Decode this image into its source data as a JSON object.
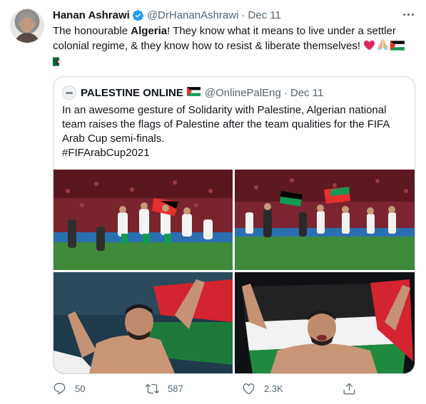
{
  "tweet": {
    "author_name": "Hanan Ashrawi",
    "handle": "@DrHananAshrawi",
    "separator": "·",
    "date": "Dec 11",
    "text_before": "The honourable ",
    "text_bold": "Algeria",
    "text_after": "! They know what it means to live under a settler colonial regime, & they know how to resist & liberate themselves!",
    "emojis": [
      "red-heart",
      "folded-hands",
      "palestine-flag",
      "algeria-flag"
    ]
  },
  "quote": {
    "author_name": "PALESTINE ONLINE",
    "handle": "@OnlinePalEng",
    "separator": "·",
    "date": "Dec 11",
    "text": "In an awesome gesture of Solidarity with Palestine, Algerian national team raises the flags of Palestine after the team qualities for the FIFA Arab Cup semi-finals.",
    "hashtag": "#FIFArabCup2021",
    "images": [
      "team-celebration-photo-1",
      "team-celebration-photo-2",
      "player-with-flag-photo-1",
      "player-with-flag-photo-2"
    ]
  },
  "actions": {
    "replies": "50",
    "retweets": "587",
    "likes": "2.3K"
  },
  "colors": {
    "text": "#0f1419",
    "secondary": "#536471",
    "border": "#cfd9de",
    "verified": "#1d9bf0"
  }
}
